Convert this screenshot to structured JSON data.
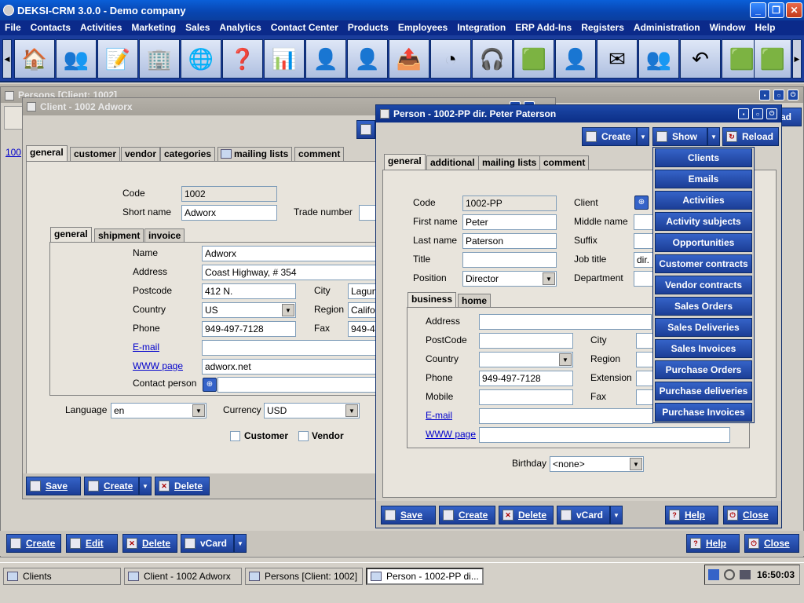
{
  "app": {
    "title": "DEKSI-CRM 3.0.0 - Demo company"
  },
  "menu": [
    "File",
    "Contacts",
    "Activities",
    "Marketing",
    "Sales",
    "Analytics",
    "Contact Center",
    "Products",
    "Employees",
    "Integration",
    "ERP Add-Ins",
    "Registers",
    "Administration",
    "Window",
    "Help"
  ],
  "toolbar_icons": [
    "house-icon",
    "contacts-icon",
    "notes-icon",
    "organization-icon",
    "globe-icon",
    "help-question-icon",
    "chart-icon",
    "person-icon",
    "person-icon",
    "export-icon",
    "pie-chart-icon",
    "call-center-agent-icon",
    "cube-icon",
    "user-icon",
    "envelope-clock-icon",
    "persons-icon",
    "undo-icon",
    "cubes-icon",
    "cube-user-icon"
  ],
  "persons_window": {
    "title": "Persons [Client: 1002]",
    "row_code": "100",
    "read_label": "ad"
  },
  "client_window": {
    "title": "Client - 1002 Adworx",
    "tabs": [
      "general",
      "customer",
      "vendor",
      "categories",
      "mailing lists",
      "comment"
    ],
    "code_label": "Code",
    "code": "1002",
    "short_name_label": "Short name",
    "short_name": "Adworx",
    "trade_number_label": "Trade number",
    "subtabs": [
      "general",
      "shipment",
      "invoice"
    ],
    "name_label": "Name",
    "name": "Adworx",
    "address_label": "Address",
    "address": "Coast Highway, # 354",
    "postcode_label": "Postcode",
    "postcode": "412 N.",
    "city_label": "City",
    "city": "Lagun",
    "country_label": "Country",
    "country": "US",
    "region_label": "Region",
    "region": "Califo",
    "phone_label": "Phone",
    "phone": "949-497-7128",
    "fax_label": "Fax",
    "fax": "949-4",
    "email_label": "E-mail",
    "www_label": "WWW page",
    "www": "adworx.net",
    "contact_label": "Contact person",
    "language_label": "Language",
    "language": "en",
    "currency_label": "Currency",
    "currency": "USD",
    "customer_label": "Customer",
    "vendor_label": "Vendor",
    "save": "Save",
    "create": "Create",
    "delete": "Delete"
  },
  "person_window": {
    "title": "Person - 1002-PP dir. Peter Paterson",
    "create": "Create",
    "show": "Show",
    "reload": "Reload",
    "tabs": [
      "general",
      "additional",
      "mailing lists",
      "comment"
    ],
    "code_label": "Code",
    "code": "1002-PP",
    "client_label": "Client",
    "first_name_label": "First name",
    "first_name": "Peter",
    "middle_name_label": "Middle name",
    "last_name_label": "Last name",
    "last_name": "Paterson",
    "suffix_label": "Suffix",
    "title_label": "Title",
    "job_title_label": "Job title",
    "job_title": "dir.",
    "position_label": "Position",
    "position": "Director",
    "department_label": "Department",
    "subtabs": [
      "business",
      "home"
    ],
    "address_label": "Address",
    "postcode_label": "PostCode",
    "city_label": "City",
    "country_label": "Country",
    "region_label": "Region",
    "phone_label": "Phone",
    "phone": "949-497-7128",
    "extension_label": "Extension",
    "mobile_label": "Mobile",
    "fax_label": "Fax",
    "email_label": "E-mail",
    "www_label": "WWW page",
    "birthday_label": "Birthday",
    "birthday": "<none>",
    "save": "Save",
    "create_bottom": "Create",
    "delete": "Delete",
    "vcard": "vCard",
    "help": "Help",
    "close": "Close"
  },
  "show_menu": [
    "Clients",
    "Emails",
    "Activities",
    "Activity subjects",
    "Opportunities",
    "Customer contracts",
    "Vendor contracts",
    "Sales Orders",
    "Sales Deliveries",
    "Sales Invoices",
    "Purchase Orders",
    "Purchase deliveries",
    "Purchase Invoices"
  ],
  "bottom_bar": {
    "create": "Create",
    "edit": "Edit",
    "delete": "Delete",
    "vcard": "vCard",
    "help": "Help",
    "close": "Close"
  },
  "taskbar": {
    "items": [
      "Clients",
      "Client - 1002 Adworx",
      "Persons [Client: 1002]",
      "Person - 1002-PP di..."
    ],
    "time": "16:50:03"
  }
}
